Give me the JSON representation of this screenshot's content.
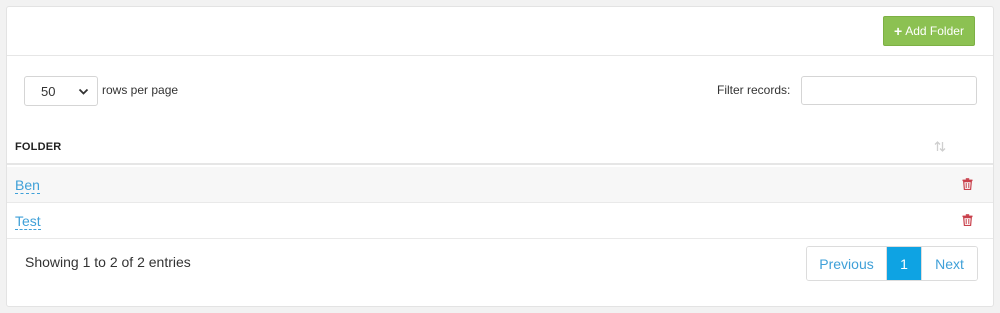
{
  "header": {
    "add_folder_label": "Add Folder"
  },
  "controls": {
    "rows_per_page_value": "50",
    "rows_per_page_label": "rows per page",
    "filter_label": "Filter records:",
    "filter_value": ""
  },
  "table": {
    "column_header": "FOLDER",
    "rows": [
      {
        "name": "Ben"
      },
      {
        "name": "Test"
      }
    ]
  },
  "footer": {
    "info": "Showing 1 to 2 of 2 entries",
    "pagination": {
      "previous": "Previous",
      "current": "1",
      "next": "Next"
    }
  },
  "colors": {
    "add_button": "#8cc152",
    "link": "#3fa0d8",
    "active_page": "#0ea3e3",
    "trash_icon": "#c9404b"
  },
  "icons": {
    "add": "plus-icon",
    "select": "chevron-down-icon",
    "sort": "sort-icon",
    "delete": "trash-icon"
  }
}
